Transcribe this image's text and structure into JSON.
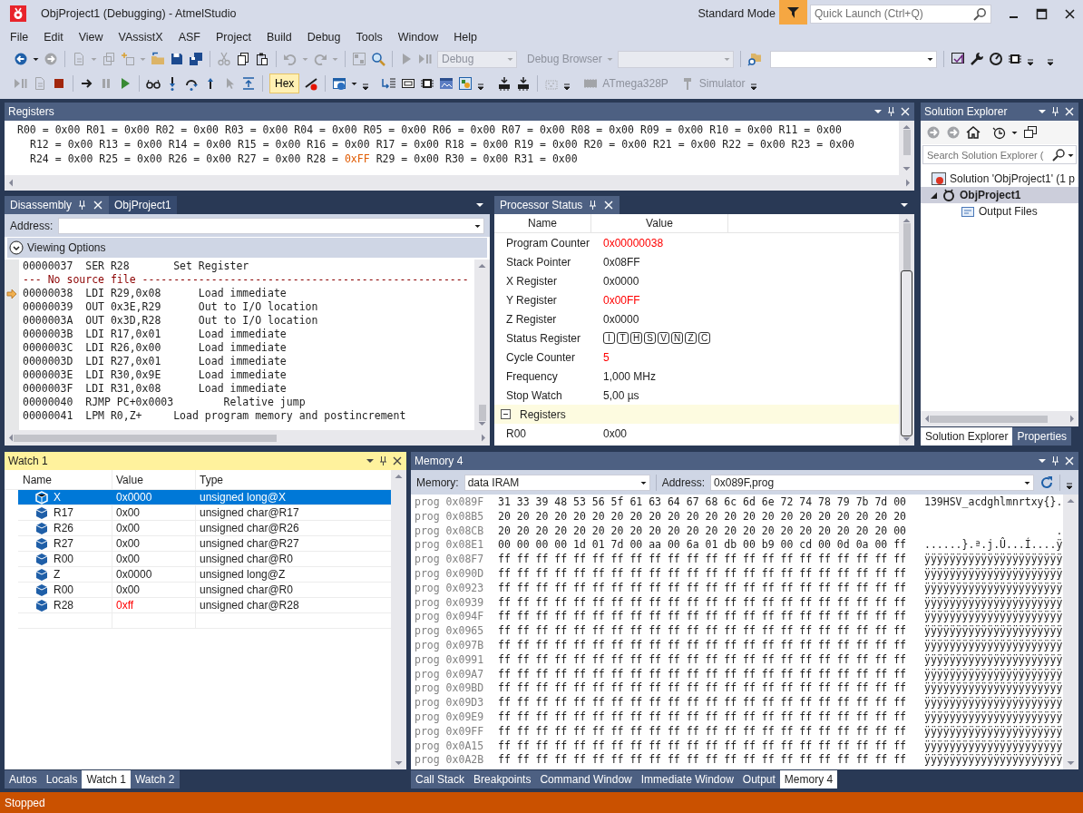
{
  "window": {
    "title": "ObjProject1 (Debugging) - AtmelStudio",
    "mode": "Standard Mode",
    "quick_launch": {
      "placeholder": "Quick Launch (Ctrl+Q)"
    }
  },
  "menu": [
    "File",
    "Edit",
    "View",
    "VAssistX",
    "ASF",
    "Project",
    "Build",
    "Debug",
    "Tools",
    "Window",
    "Help"
  ],
  "toolbar": {
    "configuration": {
      "value": "Debug",
      "disabled": true
    },
    "debug_browser": {
      "label": "Debug Browser",
      "disabled": true
    },
    "hex": {
      "label": "Hex",
      "on": true
    },
    "device": {
      "label": "ATmega328P",
      "disabled": true
    },
    "tool": {
      "label": "Simulator",
      "disabled": true
    }
  },
  "registers": {
    "title": "Registers",
    "active": false,
    "lines": [
      [
        {
          "name": "R00 =",
          "value": "0x00",
          "changed": false
        },
        {
          "name": "R01 =",
          "value": "0x00",
          "changed": false
        },
        {
          "name": "R02 =",
          "value": "0x00",
          "changed": false
        },
        {
          "name": "R03 =",
          "value": "0x00",
          "changed": false
        },
        {
          "name": "R04 =",
          "value": "0x00",
          "changed": false
        },
        {
          "name": "R05 =",
          "value": "0x00",
          "changed": false
        },
        {
          "name": "R06 =",
          "value": "0x00",
          "changed": false
        },
        {
          "name": "R07 =",
          "value": "0x00",
          "changed": false
        },
        {
          "name": "R08 =",
          "value": "0x00",
          "changed": false
        },
        {
          "name": "R09 =",
          "value": "0x00",
          "changed": false
        },
        {
          "name": "R10 =",
          "value": "0x00",
          "changed": false
        },
        {
          "name": "R11 =",
          "value": "0x00",
          "changed": false
        }
      ],
      [
        {
          "name": "R12 =",
          "value": "0x00",
          "changed": false
        },
        {
          "name": "R13 =",
          "value": "0x00",
          "changed": false
        },
        {
          "name": "R14 =",
          "value": "0x00",
          "changed": false
        },
        {
          "name": "R15 =",
          "value": "0x00",
          "changed": false
        },
        {
          "name": "R16 =",
          "value": "0x00",
          "changed": false
        },
        {
          "name": "R17 =",
          "value": "0x00",
          "changed": false
        },
        {
          "name": "R18 =",
          "value": "0x00",
          "changed": false
        },
        {
          "name": "R19 =",
          "value": "0x00",
          "changed": false
        },
        {
          "name": "R20 =",
          "value": "0x00",
          "changed": false
        },
        {
          "name": "R21 =",
          "value": "0x00",
          "changed": false
        },
        {
          "name": "R22 =",
          "value": "0x00",
          "changed": false
        },
        {
          "name": "R23 =",
          "value": "0x00",
          "changed": false
        }
      ],
      [
        {
          "name": "R24 =",
          "value": "0x00",
          "changed": false
        },
        {
          "name": "R25 =",
          "value": "0x00",
          "changed": false
        },
        {
          "name": "R26 =",
          "value": "0x00",
          "changed": false
        },
        {
          "name": "R27 =",
          "value": "0x00",
          "changed": false
        },
        {
          "name": "R28 =",
          "value": "0xFF",
          "changed": true
        },
        {
          "name": "R29 =",
          "value": "0x00",
          "changed": false
        },
        {
          "name": "R30 =",
          "value": "0x00",
          "changed": false
        },
        {
          "name": "R31 =",
          "value": "0x00",
          "changed": false
        }
      ]
    ]
  },
  "disassembly": {
    "tabs": [
      {
        "label": "Disassembly",
        "selected": true
      },
      {
        "label": "ObjProject1",
        "selected": false
      }
    ],
    "address_label": "Address:",
    "viewing_options": "Viewing Options",
    "lines": [
      {
        "kind": "code",
        "text": "00000037  SER R28       Set Register",
        "current": false
      },
      {
        "kind": "separator",
        "text": "--- No source file ----------------------------------------------------"
      },
      {
        "kind": "code",
        "text": "00000038  LDI R29,0x08      Load immediate",
        "current": true
      },
      {
        "kind": "code",
        "text": "00000039  OUT 0x3E,R29      Out to I/O location",
        "current": false
      },
      {
        "kind": "code",
        "text": "0000003A  OUT 0x3D,R28      Out to I/O location",
        "current": false
      },
      {
        "kind": "code",
        "text": "0000003B  LDI R17,0x01      Load immediate",
        "current": false
      },
      {
        "kind": "code",
        "text": "0000003C  LDI R26,0x00      Load immediate",
        "current": false
      },
      {
        "kind": "code",
        "text": "0000003D  LDI R27,0x01      Load immediate",
        "current": false
      },
      {
        "kind": "code",
        "text": "0000003E  LDI R30,0x9E      Load immediate",
        "current": false
      },
      {
        "kind": "code",
        "text": "0000003F  LDI R31,0x08      Load immediate",
        "current": false
      },
      {
        "kind": "code",
        "text": "00000040  RJMP PC+0x0003        Relative jump",
        "current": false
      },
      {
        "kind": "code",
        "text": "00000041  LPM R0,Z+     Load program memory and postincrement",
        "current": false
      }
    ]
  },
  "processor_status": {
    "tabs": [
      {
        "label": "Processor Status",
        "selected": true
      }
    ],
    "columns": [
      "Name",
      "Value"
    ],
    "rows": [
      {
        "kind": "value",
        "name": "Program Counter",
        "value": "0x00000038",
        "changed": true
      },
      {
        "kind": "value",
        "name": "Stack Pointer",
        "value": "0x08FF",
        "changed": false
      },
      {
        "kind": "value",
        "name": "X Register",
        "value": "0x0000",
        "changed": false
      },
      {
        "kind": "value",
        "name": "Y Register",
        "value": "0x00FF",
        "changed": true
      },
      {
        "kind": "value",
        "name": "Z Register",
        "value": "0x0000",
        "changed": false
      },
      {
        "kind": "flags",
        "name": "Status Register",
        "flags": [
          {
            "label": "I",
            "set": false
          },
          {
            "label": "T",
            "set": false
          },
          {
            "label": "H",
            "set": false
          },
          {
            "label": "S",
            "set": false
          },
          {
            "label": "V",
            "set": false
          },
          {
            "label": "N",
            "set": false
          },
          {
            "label": "Z",
            "set": false
          },
          {
            "label": "C",
            "set": false
          }
        ]
      },
      {
        "kind": "value",
        "name": "Cycle Counter",
        "value": "5",
        "changed": true
      },
      {
        "kind": "value",
        "name": "Frequency",
        "value": "1,000 MHz",
        "changed": false
      },
      {
        "kind": "value",
        "name": "Stop Watch",
        "value": "5,00 µs",
        "changed": false
      }
    ],
    "groups": [
      {
        "label": "Registers",
        "expanded": true,
        "rows": [
          {
            "name": "R00",
            "value": "0x00",
            "changed": false
          }
        ]
      }
    ]
  },
  "solution_explorer": {
    "title": "Solution Explorer",
    "active": false,
    "search": {
      "placeholder": "Search Solution Explorer ("
    },
    "tree": [
      {
        "kind": "solution",
        "label": "Solution 'ObjProject1' (1 p",
        "selected": false,
        "children": [
          {
            "kind": "project",
            "label": "ObjProject1",
            "selected": true,
            "expanded": true,
            "children": [
              {
                "kind": "output",
                "label": "Output Files",
                "selected": false
              }
            ]
          }
        ]
      }
    ],
    "tabs": [
      {
        "label": "Solution Explorer",
        "selected": true
      },
      {
        "label": "Properties",
        "selected": false
      }
    ]
  },
  "watch": {
    "title": "Watch 1",
    "active": true,
    "columns": [
      "Name",
      "Value",
      "Type"
    ],
    "rows": [
      {
        "name": "X",
        "value": "0x0000",
        "type": "unsigned long@X",
        "selected": true,
        "changed": false
      },
      {
        "name": "R17",
        "value": "0x00",
        "type": "unsigned char@R17",
        "selected": false,
        "changed": false
      },
      {
        "name": "R26",
        "value": "0x00",
        "type": "unsigned char@R26",
        "selected": false,
        "changed": false
      },
      {
        "name": "R27",
        "value": "0x00",
        "type": "unsigned char@R27",
        "selected": false,
        "changed": false
      },
      {
        "name": "R00",
        "value": "0x00",
        "type": "unsigned char@R0",
        "selected": false,
        "changed": false
      },
      {
        "name": "Z",
        "value": "0x0000",
        "type": "unsigned long@Z",
        "selected": false,
        "changed": false
      },
      {
        "name": "R00",
        "value": "0x00",
        "type": "unsigned char@R0",
        "selected": false,
        "changed": false
      },
      {
        "name": "R28",
        "value": "0xff",
        "type": "unsigned char@R28",
        "selected": false,
        "changed": true
      }
    ],
    "tabs": [
      {
        "label": "Autos",
        "selected": false
      },
      {
        "label": "Locals",
        "selected": false
      },
      {
        "label": "Watch 1",
        "selected": true
      },
      {
        "label": "Watch 2",
        "selected": false
      }
    ]
  },
  "memory": {
    "title": "Memory 4",
    "active": false,
    "memory_label": "Memory:",
    "memory": "data IRAM",
    "address_label": "Address:",
    "address": "0x089F,prog",
    "rows": [
      {
        "address": "prog 0x089F",
        "bytes": "31 33 39 48 53 56 5f 61 63 64 67 68 6c 6d 6e 72 74 78 79 7b 7d 00",
        "ascii": "139HSV_acdghlmnrtxy{}."
      },
      {
        "address": "prog 0x08B5",
        "bytes": "20 20 20 20 20 20 20 20 20 20 20 20 20 20 20 20 20 20 20 20 20 20"
      },
      {
        "address": "prog 0x08CB",
        "bytes": "20 20 20 20 20 20 20 20 20 20 20 20 20 20 20 20 20 20 20 20 20 00",
        "ascii": "                     ."
      },
      {
        "address": "prog 0x08E1",
        "bytes": "00 00 00 00 1d 01 7d 00 aa 00 6a 01 db 00 b9 00 cd 00 0d 0a 00 ff",
        "ascii": "......}.ª.j.Û...Í....ÿ"
      },
      {
        "address": "prog 0x08F7",
        "bytes": "ff ff ff ff ff ff ff ff ff ff ff ff ff ff ff ff ff ff ff ff ff ff",
        "ascii": "ÿÿÿÿÿÿÿÿÿÿÿÿÿÿÿÿÿÿÿÿÿÿ"
      },
      {
        "address": "prog 0x090D",
        "bytes": "ff ff ff ff ff ff ff ff ff ff ff ff ff ff ff ff ff ff ff ff ff ff",
        "ascii": "ÿÿÿÿÿÿÿÿÿÿÿÿÿÿÿÿÿÿÿÿÿÿ"
      },
      {
        "address": "prog 0x0923",
        "bytes": "ff ff ff ff ff ff ff ff ff ff ff ff ff ff ff ff ff ff ff ff ff ff",
        "ascii": "ÿÿÿÿÿÿÿÿÿÿÿÿÿÿÿÿÿÿÿÿÿÿ"
      },
      {
        "address": "prog 0x0939",
        "bytes": "ff ff ff ff ff ff ff ff ff ff ff ff ff ff ff ff ff ff ff ff ff ff",
        "ascii": "ÿÿÿÿÿÿÿÿÿÿÿÿÿÿÿÿÿÿÿÿÿÿ"
      },
      {
        "address": "prog 0x094F",
        "bytes": "ff ff ff ff ff ff ff ff ff ff ff ff ff ff ff ff ff ff ff ff ff ff",
        "ascii": "ÿÿÿÿÿÿÿÿÿÿÿÿÿÿÿÿÿÿÿÿÿÿ"
      },
      {
        "address": "prog 0x0965",
        "bytes": "ff ff ff ff ff ff ff ff ff ff ff ff ff ff ff ff ff ff ff ff ff ff",
        "ascii": "ÿÿÿÿÿÿÿÿÿÿÿÿÿÿÿÿÿÿÿÿÿÿ"
      },
      {
        "address": "prog 0x097B",
        "bytes": "ff ff ff ff ff ff ff ff ff ff ff ff ff ff ff ff ff ff ff ff ff ff",
        "ascii": "ÿÿÿÿÿÿÿÿÿÿÿÿÿÿÿÿÿÿÿÿÿÿ"
      },
      {
        "address": "prog 0x0991",
        "bytes": "ff ff ff ff ff ff ff ff ff ff ff ff ff ff ff ff ff ff ff ff ff ff",
        "ascii": "ÿÿÿÿÿÿÿÿÿÿÿÿÿÿÿÿÿÿÿÿÿÿ"
      },
      {
        "address": "prog 0x09A7",
        "bytes": "ff ff ff ff ff ff ff ff ff ff ff ff ff ff ff ff ff ff ff ff ff ff",
        "ascii": "ÿÿÿÿÿÿÿÿÿÿÿÿÿÿÿÿÿÿÿÿÿÿ"
      },
      {
        "address": "prog 0x09BD",
        "bytes": "ff ff ff ff ff ff ff ff ff ff ff ff ff ff ff ff ff ff ff ff ff ff",
        "ascii": "ÿÿÿÿÿÿÿÿÿÿÿÿÿÿÿÿÿÿÿÿÿÿ"
      },
      {
        "address": "prog 0x09D3",
        "bytes": "ff ff ff ff ff ff ff ff ff ff ff ff ff ff ff ff ff ff ff ff ff ff",
        "ascii": "ÿÿÿÿÿÿÿÿÿÿÿÿÿÿÿÿÿÿÿÿÿÿ"
      },
      {
        "address": "prog 0x09E9",
        "bytes": "ff ff ff ff ff ff ff ff ff ff ff ff ff ff ff ff ff ff ff ff ff ff",
        "ascii": "ÿÿÿÿÿÿÿÿÿÿÿÿÿÿÿÿÿÿÿÿÿÿ"
      },
      {
        "address": "prog 0x09FF",
        "bytes": "ff ff ff ff ff ff ff ff ff ff ff ff ff ff ff ff ff ff ff ff ff ff",
        "ascii": "ÿÿÿÿÿÿÿÿÿÿÿÿÿÿÿÿÿÿÿÿÿÿ"
      },
      {
        "address": "prog 0x0A15",
        "bytes": "ff ff ff ff ff ff ff ff ff ff ff ff ff ff ff ff ff ff ff ff ff ff",
        "ascii": "ÿÿÿÿÿÿÿÿÿÿÿÿÿÿÿÿÿÿÿÿÿÿ"
      },
      {
        "address": "prog 0x0A2B",
        "bytes": "ff ff ff ff ff ff ff ff ff ff ff ff ff ff ff ff ff ff ff ff ff ff",
        "ascii": "ÿÿÿÿÿÿÿÿÿÿÿÿÿÿÿÿÿÿÿÿÿÿ"
      }
    ],
    "tabs": [
      {
        "label": "Call Stack",
        "selected": false
      },
      {
        "label": "Breakpoints",
        "selected": false
      },
      {
        "label": "Command Window",
        "selected": false
      },
      {
        "label": "Immediate Window",
        "selected": false
      },
      {
        "label": "Output",
        "selected": false
      },
      {
        "label": "Memory 4",
        "selected": true
      }
    ]
  },
  "status_bar": "Stopped"
}
